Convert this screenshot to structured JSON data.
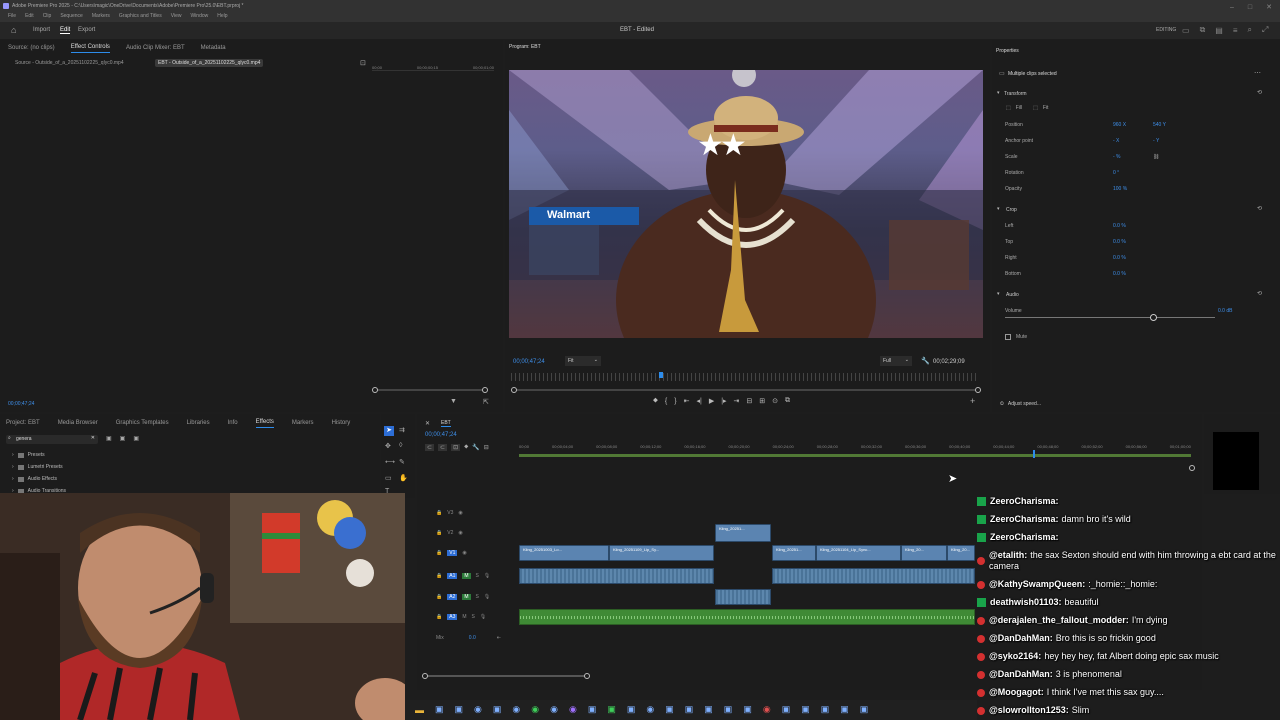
{
  "window": {
    "title": "Adobe Premiere Pro 2025 - C:\\Users\\magic\\OneDrive\\Documents\\Adobe\\Premiere Pro\\25.0\\EBT.prproj *",
    "menu": [
      "File",
      "Edit",
      "Clip",
      "Sequence",
      "Markers",
      "Graphics and Titles",
      "View",
      "Window",
      "Help"
    ]
  },
  "header": {
    "nav": [
      "Import",
      "Edit",
      "Export"
    ],
    "active_nav": "Edit",
    "center_title": "EBT - Edited",
    "workspace": "EDITING"
  },
  "source_panel": {
    "tabs": [
      "Source: (no clips)",
      "Effect Controls",
      "Audio Clip Mixer: EBT",
      "Metadata"
    ],
    "source_label": "Source - Outside_of_a_20251102225_qlyc0.mp4",
    "seq_label": "EBT - Outside_of_a_20251102225_qlyc0.mp4",
    "ruler": [
      "00;00",
      "00;00;00;15",
      "00;00;01;00"
    ],
    "timecode": "00;00;47;24"
  },
  "program": {
    "tab": "Program: EBT",
    "timecode": "00;00;47;24",
    "fit": "Fit",
    "quality": "Full",
    "duration": "00;02;29;09",
    "video_sign": "Walmart"
  },
  "properties": {
    "tab": "Properties",
    "title": "Multiple clips selected",
    "transform_title": "Transform",
    "fill_labels": [
      "Fill",
      "Fit"
    ],
    "rows": [
      {
        "label": "Position",
        "v1": "960 X",
        "v2": "540 Y"
      },
      {
        "label": "Anchor point",
        "v1": "- X",
        "v2": "- Y"
      },
      {
        "label": "Scale",
        "v1": "- %",
        "v2": ""
      },
      {
        "label": "Rotation",
        "v1": "0 °",
        "v2": ""
      },
      {
        "label": "Opacity",
        "v1": "100 %",
        "v2": ""
      }
    ],
    "crop_title": "Crop",
    "crop_rows": [
      {
        "label": "Left",
        "value": "0.0 %"
      },
      {
        "label": "Top",
        "value": "0.0 %"
      },
      {
        "label": "Right",
        "value": "0.0 %"
      },
      {
        "label": "Bottom",
        "value": "0.0 %"
      }
    ],
    "audio_title": "Audio",
    "volume_label": "Volume",
    "volume_value": "0.0 dB",
    "mute_label": "Mute",
    "adjust_speed": "Adjust speed..."
  },
  "project_panel": {
    "tabs": [
      "Project: EBT",
      "Media Browser",
      "Graphics Templates",
      "Libraries",
      "Info",
      "Effects",
      "Markers",
      "History"
    ],
    "active_tab": "Effects",
    "search_value": "genera",
    "tree": [
      "Presets",
      "Lumetri Presets",
      "Audio Effects",
      "Audio Transitions"
    ]
  },
  "timeline": {
    "tab": "EBT",
    "timecode": "00;00;47;24",
    "ruler": [
      "00;00",
      "00;00;04;00",
      "00;00;08;00",
      "00;00;12;00",
      "00;00;16;00",
      "00;00;20;00",
      "00;00;24;00",
      "00;00;28;00",
      "00;00;32;00",
      "00;00;36;00",
      "00;00;40;00",
      "00;00;44;00",
      "00;00;48;00",
      "00;00;52;00",
      "00;00;56;00",
      "00;01;00;00"
    ],
    "tracks": [
      "V3",
      "V2",
      "V1",
      "A1",
      "A2",
      "A3",
      "Mix"
    ],
    "mix_value": "0.0",
    "clips": [
      {
        "label": "Kling_20251..."
      },
      {
        "label": "Kling_20251003_Lo..."
      },
      {
        "label": "Kling_20251109_Lip_Sy..."
      },
      {
        "label": "Kling_20251..."
      },
      {
        "label": "Kling_20..."
      },
      {
        "label": "Kling_20251104_Lip_Sync..."
      },
      {
        "label": "Kling_20..."
      }
    ]
  },
  "chat": [
    {
      "user": "ZeeroCharisma:",
      "msg": "",
      "badge": "green"
    },
    {
      "user": "ZeeroCharisma:",
      "msg": "damn bro it's wild",
      "badge": "green"
    },
    {
      "user": "ZeeroCharisma:",
      "msg": "",
      "badge": "green"
    },
    {
      "user": "@etalith:",
      "msg": "the sax Sexton should end with him throwing a ebt card at the camera",
      "badge": "red"
    },
    {
      "user": "@KathySwampQueen:",
      "msg": ":_homie::_homie:",
      "badge": "red"
    },
    {
      "user": "deathwish01103:",
      "msg": "beautiful",
      "badge": "green"
    },
    {
      "user": "@derajalen_the_fallout_modder:",
      "msg": "I'm dying",
      "badge": "red"
    },
    {
      "user": "@DanDahMan:",
      "msg": "Bro this is so frickin good",
      "badge": "red"
    },
    {
      "user": "@syko2164:",
      "msg": "hey hey hey, fat Albert doing epic sax music",
      "badge": "red"
    },
    {
      "user": "@DanDahMan:",
      "msg": "3 is phenomenal",
      "badge": "red"
    },
    {
      "user": "@Moogagot:",
      "msg": "I think I've met this sax guy....",
      "badge": "red"
    },
    {
      "user": "@slowrollton1253:",
      "msg": "Slim",
      "badge": "red"
    }
  ],
  "colors": {
    "accent": "#2d8ceb",
    "clip_video": "#5b84b1",
    "clip_audio": "#3f8a35",
    "chat_green": "#19a34a",
    "chat_red": "#d43030"
  }
}
